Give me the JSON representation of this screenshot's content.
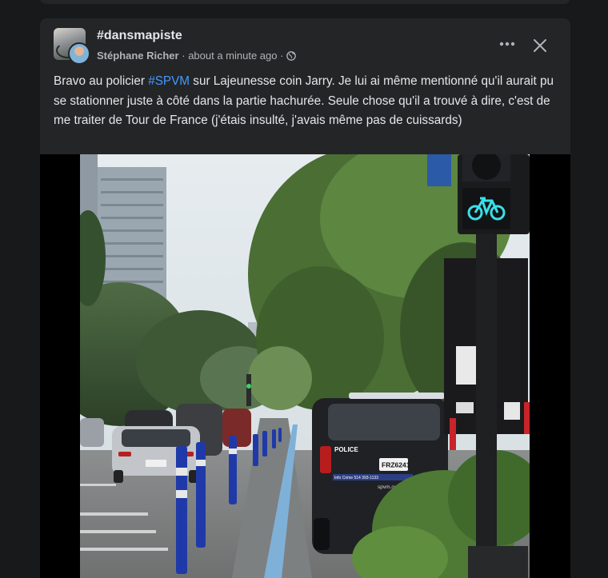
{
  "post": {
    "group_name": "#dansmapiste",
    "author": "Stéphane Richer",
    "timestamp": "about a minute ago",
    "separator": "·",
    "privacy_icon": "globe-icon",
    "more_icon": "more-horizontal-icon",
    "close_icon": "close-icon",
    "text_before_tag": "Bravo au policier ",
    "hashtag": "#SPVM",
    "text_after_tag": " sur Lajeunesse coin Jarry. Je lui ai même mentionné qu'il aurait pu se stationner juste à côté dans la partie hachurée. Seule chose qu'il a trouvé à dire, c'est de me traiter de Tour de France (j'étais insulté, j'avais même pas de cuissards)"
  },
  "photo": {
    "police_label": "POLICE",
    "plate": "FRZ6241",
    "info_crime": "Info Crime 514 393-1133",
    "website": "spvm.qc.ca",
    "bike_signal_icon": "bicycle-icon"
  },
  "colors": {
    "background": "#18191a",
    "card": "#242526",
    "text": "#e4e6eb",
    "secondary_text": "#b0b3b8",
    "link": "#4599ff",
    "bike_signal": "#39e0e8"
  }
}
